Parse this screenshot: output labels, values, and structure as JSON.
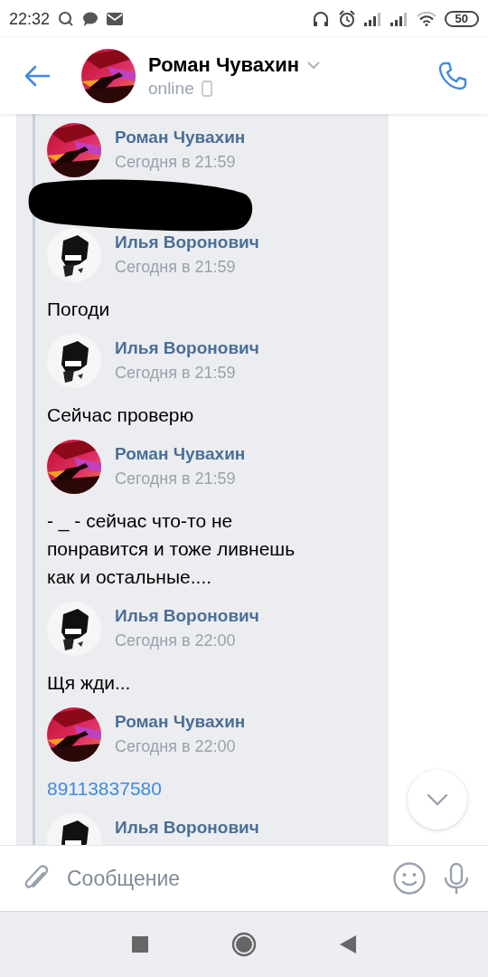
{
  "status_bar": {
    "time": "22:32",
    "battery": "50"
  },
  "header": {
    "name": "Роман Чувахин",
    "status": "online"
  },
  "messages": [
    {
      "author": "Роман Чувахин",
      "time": "Сегодня в 21:59",
      "redacted": true
    },
    {
      "author": "Илья Воронович",
      "time": "Сегодня в 21:59",
      "kind": "text",
      "text": "Погоди"
    },
    {
      "author": "Илья Воронович",
      "time": "Сегодня в 21:59",
      "kind": "text",
      "text": "Сейчас проверю"
    },
    {
      "author": "Роман Чувахин",
      "time": "Сегодня в 21:59",
      "kind": "text",
      "text": "- _ - сейчас что-то не понравится и тоже ливнешь как и остальные...."
    },
    {
      "author": "Илья Воронович",
      "time": "Сегодня в 22:00",
      "kind": "text",
      "text": "Щя жди..."
    },
    {
      "author": "Роман Чувахин",
      "time": "Сегодня в 22:00",
      "kind": "link",
      "text": "89113837580"
    },
    {
      "author": "Илья Воронович"
    }
  ],
  "composer": {
    "placeholder": "Сообщение"
  }
}
